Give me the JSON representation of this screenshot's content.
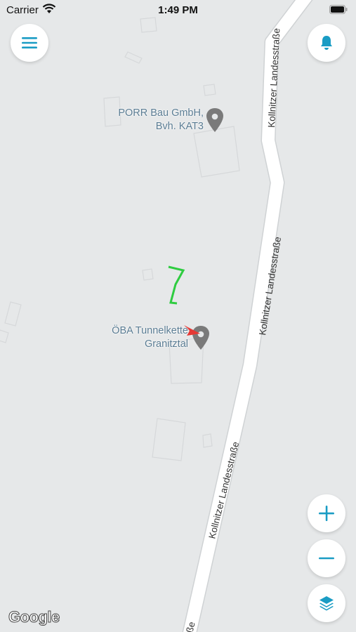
{
  "status_bar": {
    "carrier": "Carrier",
    "time": "1:49 PM"
  },
  "map": {
    "road_name": "Kollnitzer Landesstraße",
    "pois": [
      {
        "line1": "PORR Bau GmbH,",
        "line2": "Bvh. KAT3",
        "icon": "map-pin-icon"
      },
      {
        "line1": "ÖBA Tunnelkette",
        "line2": "Granitztal",
        "icon": "map-pin-icon"
      }
    ],
    "attribution": "Google"
  },
  "controls": {
    "menu_icon": "hamburger-menu-icon",
    "notifications_icon": "bell-icon",
    "zoom_in_icon": "plus-icon",
    "zoom_out_icon": "minus-icon",
    "layers_icon": "layers-icon"
  },
  "colors": {
    "accent": "#1a9cc4",
    "road": "#ffffff",
    "map_bg": "#e6e8e9",
    "track": "#2ecc40",
    "location_arrow": "#e53935"
  }
}
